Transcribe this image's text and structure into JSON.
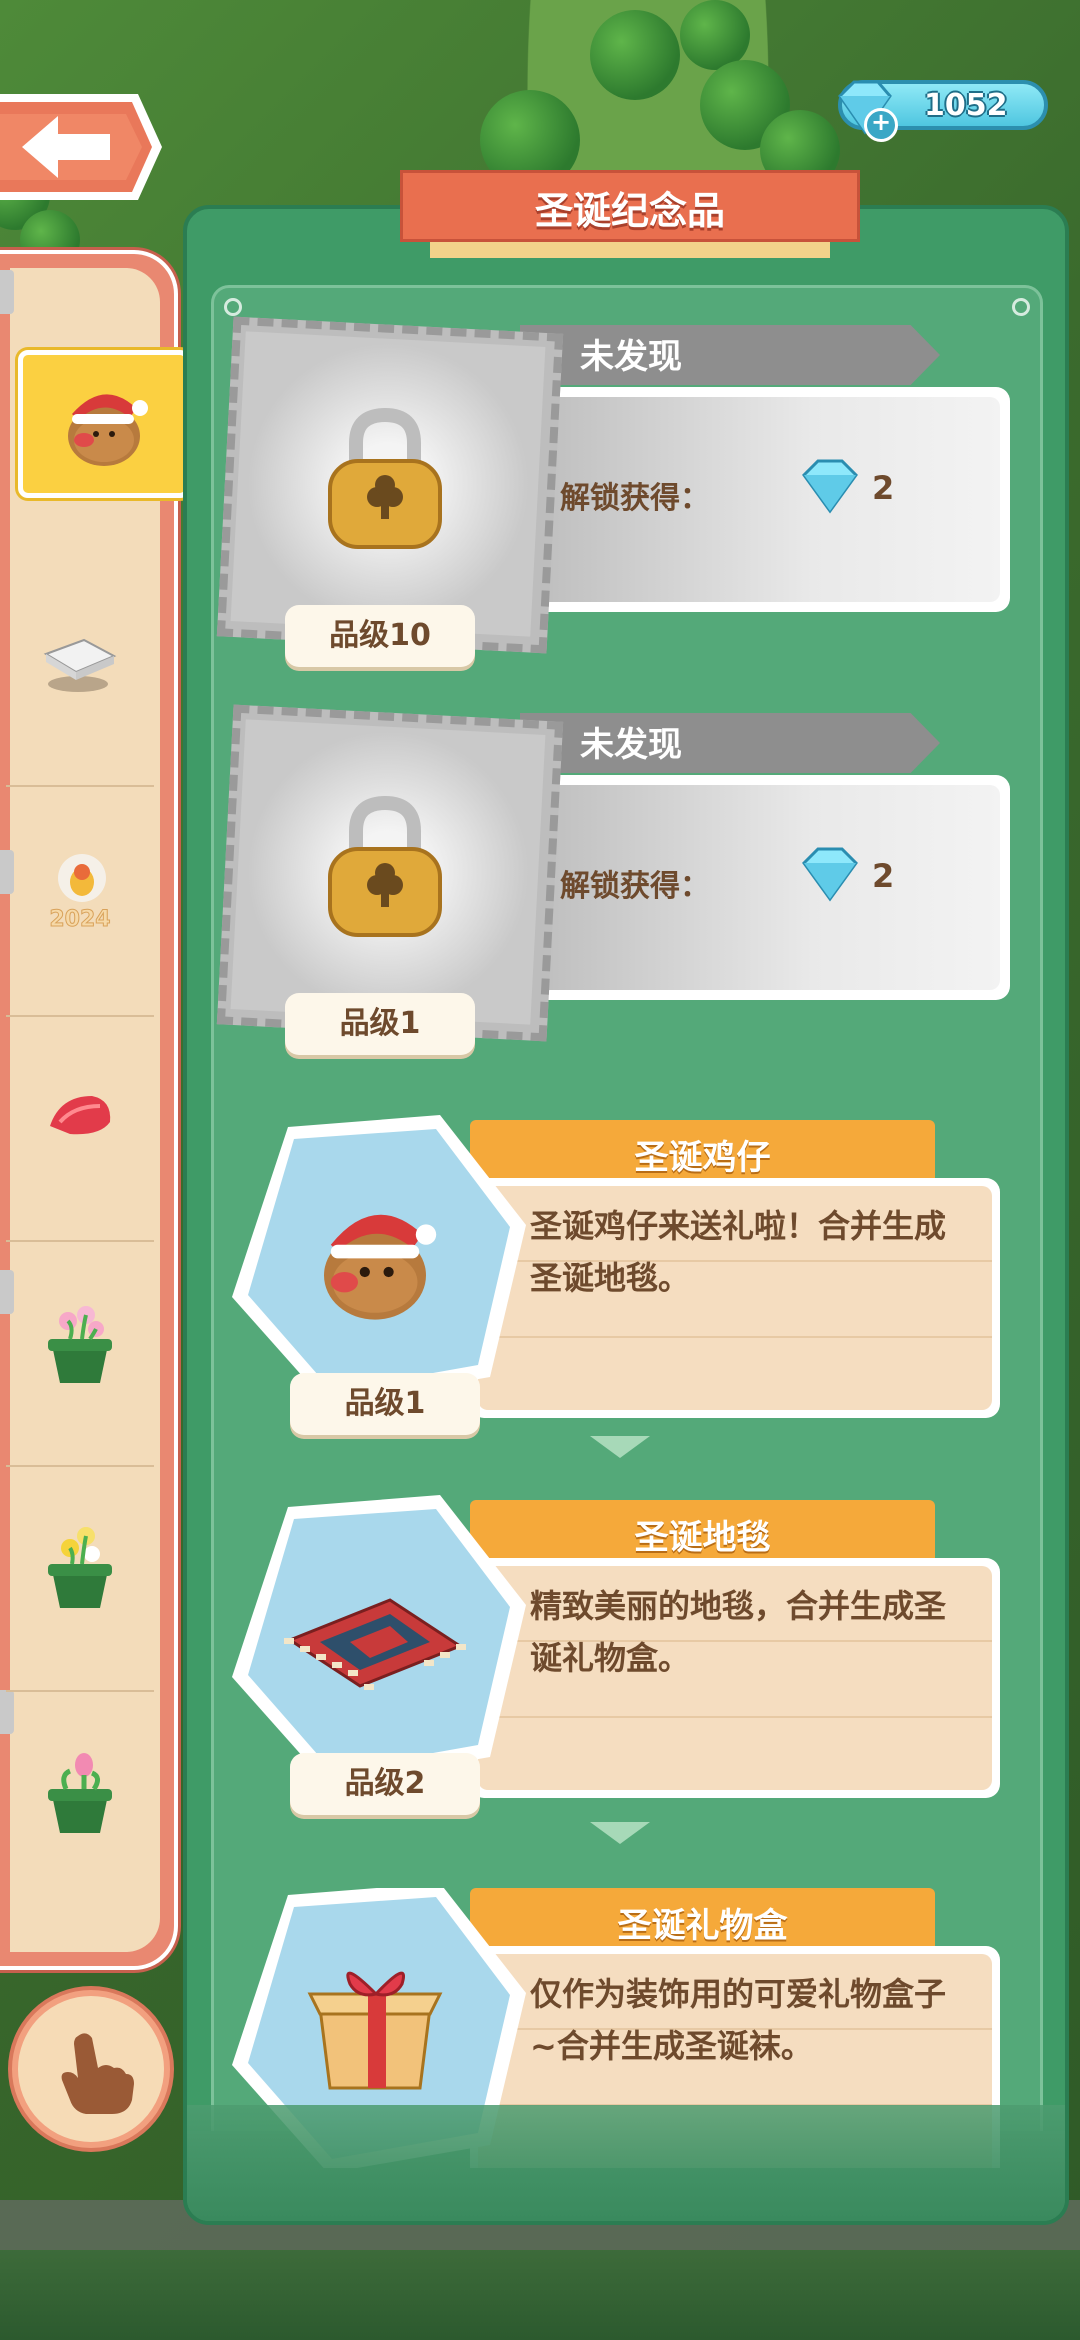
{
  "header": {
    "title": "圣诞纪念品",
    "gems": "1052"
  },
  "rail": {
    "items": [
      {
        "name": "christmas-chick",
        "active": true
      },
      {
        "name": "paper-bundle",
        "active": false
      },
      {
        "name": "new-year-2024",
        "active": false
      },
      {
        "name": "red-petal",
        "active": false
      },
      {
        "name": "pink-flower-pot",
        "active": false
      },
      {
        "name": "yellow-flower-pot",
        "active": false
      },
      {
        "name": "tulip-pot",
        "active": false
      }
    ]
  },
  "locked_cards": [
    {
      "status": "未发现",
      "unlock_label": "解锁获得：",
      "reward": "2",
      "grade": "品级10"
    },
    {
      "status": "未发现",
      "unlock_label": "解锁获得：",
      "reward": "2",
      "grade": "品级1"
    }
  ],
  "items": [
    {
      "title": "圣诞鸡仔",
      "desc": "圣诞鸡仔来送礼啦！合并生成圣诞地毯。",
      "grade": "品级1"
    },
    {
      "title": "圣诞地毯",
      "desc": "精致美丽的地毯，合并生成圣诞礼物盒。",
      "grade": "品级2"
    },
    {
      "title": "圣诞礼物盒",
      "desc": "仅作为装饰用的可爱礼物盒子~合并生成圣诞袜。",
      "grade": ""
    }
  ],
  "colors": {
    "panel_green": "#3f9b67",
    "ribbon_red": "#e96f4f",
    "tab_orange": "#f5a93a",
    "text_brown": "#6e4a2d",
    "gem_blue": "#4fc6e0"
  }
}
